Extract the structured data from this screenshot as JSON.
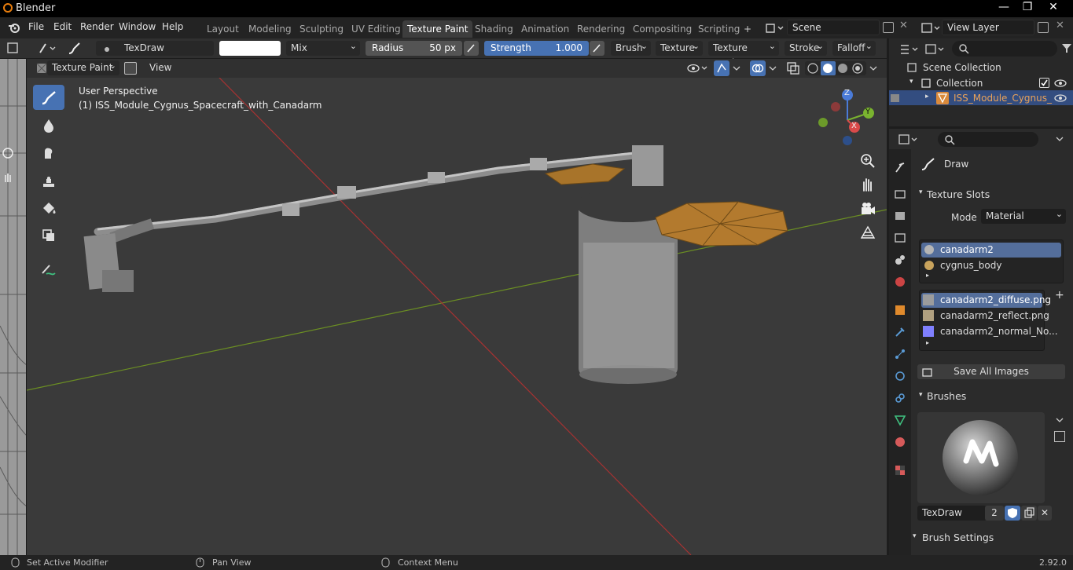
{
  "window": {
    "title": "Blender",
    "minimize": "—",
    "restore": "❐",
    "close": "✕"
  },
  "menu": [
    "File",
    "Edit",
    "Render",
    "Window",
    "Help"
  ],
  "workspaces": [
    "Layout",
    "Modeling",
    "Sculpting",
    "UV Editing",
    "Texture Paint",
    "Shading",
    "Animation",
    "Rendering",
    "Compositing",
    "Scripting"
  ],
  "active_workspace": "Texture Paint",
  "add_workspace": "+",
  "scene": {
    "name": "Scene"
  },
  "view_layer": {
    "name": "View Layer"
  },
  "tool_header": {
    "brush_name": "TexDraw",
    "blend_mode": "Mix",
    "radius_label": "Radius",
    "radius_value": "50 px",
    "strength_label": "Strength",
    "strength_value": "1.000",
    "brush_menu": "Brush",
    "texture_menu": "Texture",
    "texture_mask_menu": "Texture Mask",
    "stroke_menu": "Stroke",
    "falloff_menu": "Falloff"
  },
  "header2": {
    "mode": "Texture Paint",
    "view_menu": "View"
  },
  "viewport": {
    "perspective": "User Perspective",
    "object_label": "(1) ISS_Module_Cygnus_Spacecraft_with_Canadarm",
    "gizmo": {
      "x": "X",
      "y": "Y",
      "z": "Z"
    },
    "colors": {
      "grid_red": "#a83232",
      "grid_green": "#6b8e23",
      "background": "#3a3a3a"
    }
  },
  "outliner": {
    "scene_collection": "Scene Collection",
    "collection": "Collection",
    "object": "ISS_Module_Cygnus_"
  },
  "properties": {
    "tool_name": "Draw",
    "texture_slots_title": "Texture Slots",
    "mode_label": "Mode",
    "mode_value": "Material",
    "materials": [
      "canadarm2",
      "cygnus_body"
    ],
    "images": [
      "canadarm2_diffuse.png",
      "canadarm2_reflect.png",
      "canadarm2_normal_No..."
    ],
    "save_all_images": "Save All Images",
    "brushes_title": "Brushes",
    "brush_name": "TexDraw",
    "brush_users": "2",
    "brush_settings_title": "Brush Settings"
  },
  "status": {
    "left": "Set Active Modifier",
    "middle": "Pan View",
    "right": "Context Menu",
    "version": "2.92.0"
  },
  "accent": "#4772b3"
}
